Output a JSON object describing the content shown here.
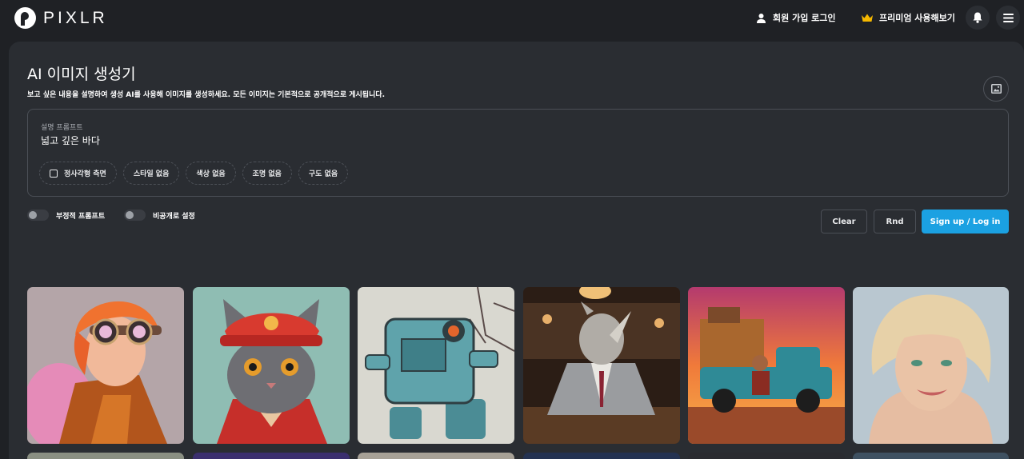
{
  "header": {
    "logo_text": "PIXLR",
    "signup_label": "회원 가입 로그인",
    "premium_label": "프리미엄 사용해보기"
  },
  "main": {
    "title": "AI 이미지 생성기",
    "subtitle": "보고 싶은 내용을 설명하여 생성 AI를 사용해 이미지를 생성하세요. 모든 이미지는 기본적으로 공개적으로 게시됩니다.",
    "prompt": {
      "label": "설명 프롬프트",
      "value": "넓고 깊은 바다"
    },
    "chips": [
      "정사각형 측면",
      "스타일 없음",
      "색상 없음",
      "조명 없음",
      "구도 없음"
    ],
    "toggles": {
      "negative_prompt": "부정적 프롬프트",
      "private": "비공개로 설정"
    },
    "buttons": {
      "clear": "Clear",
      "rnd": "Rnd",
      "login": "Sign up / Log in"
    }
  },
  "colors": {
    "accent": "#1ba1e2",
    "background": "#1f2125",
    "panel": "#2a2d32",
    "crown": "#f5b800"
  },
  "gallery": [
    "punk-redhead-goggles",
    "cat-red-hat",
    "robot-sketch",
    "rhino-in-suit-bar",
    "man-on-truck-sunset",
    "blonde-woman-portrait"
  ]
}
